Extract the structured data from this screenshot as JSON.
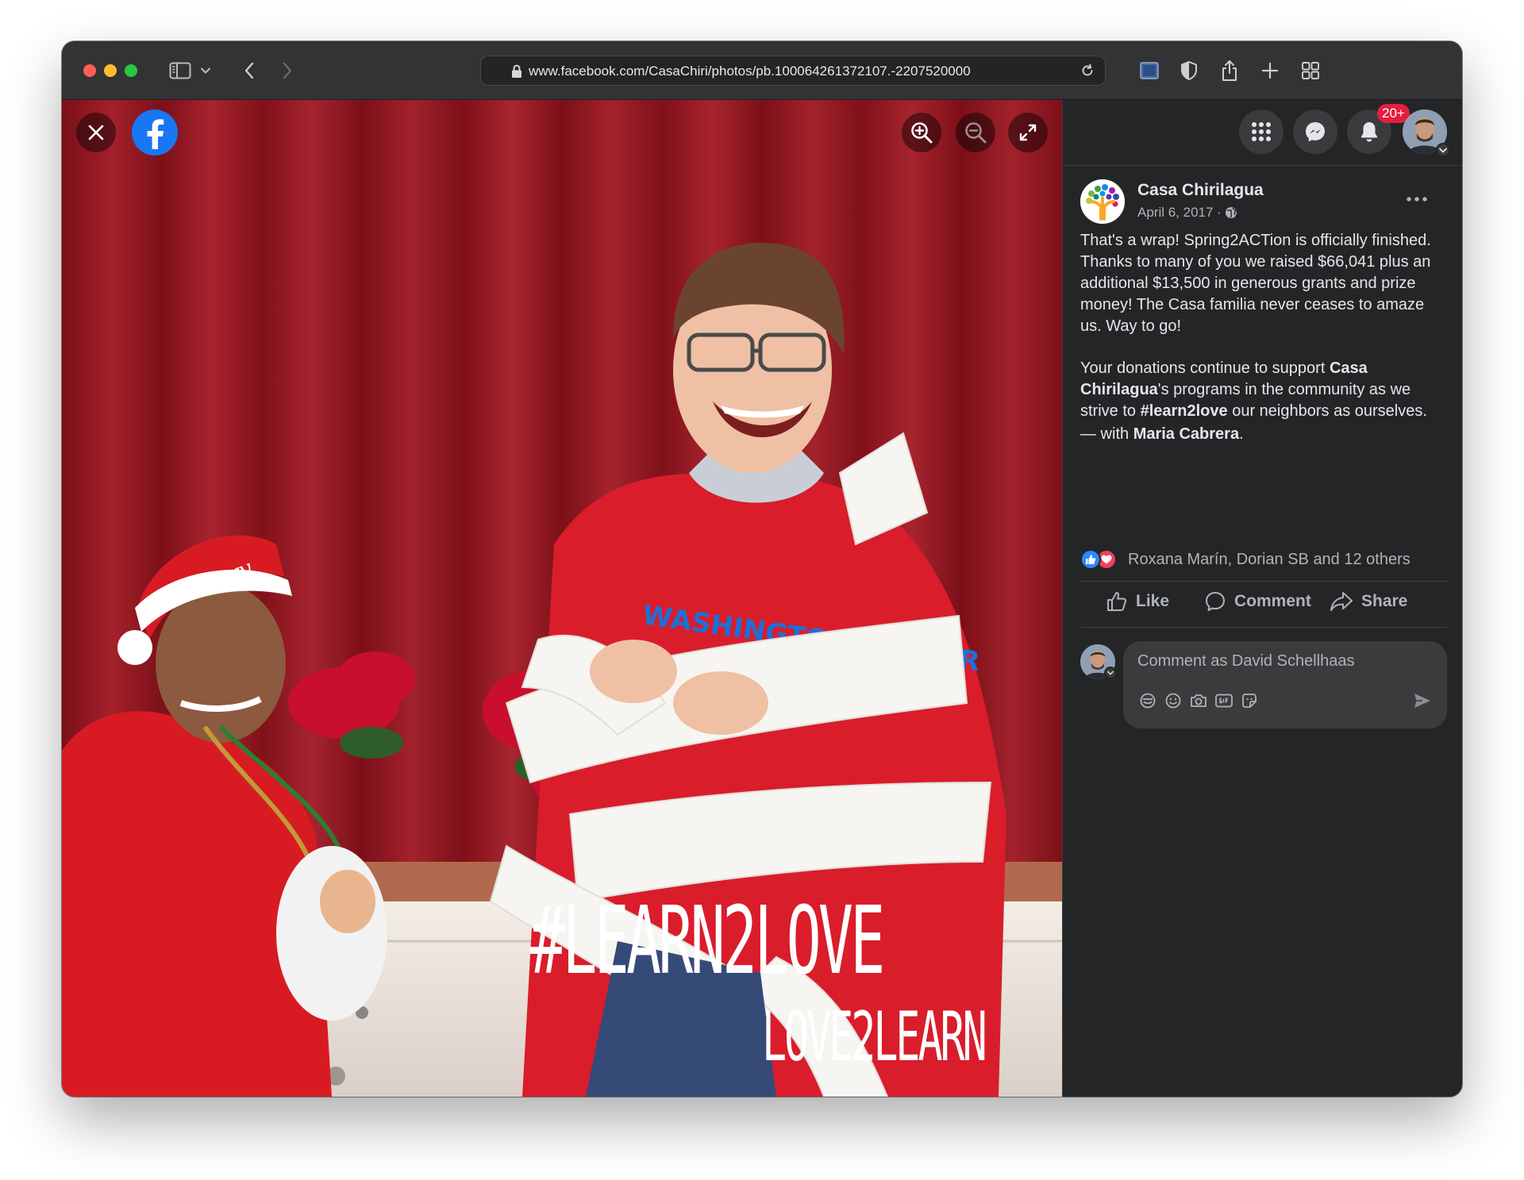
{
  "browser": {
    "url": "www.facebook.com/CasaChiri/photos/pb.100064261372107.-2207520000"
  },
  "photo": {
    "hashtag_line1": "#LEARN2LOVE",
    "hashtag_line2": "LOVE2LEARN",
    "hat_text": "Merry",
    "shirt_text": "WASHINGTON SOCCER"
  },
  "header": {
    "notification_count": "20+"
  },
  "post": {
    "page_name": "Casa Chirilagua",
    "date": "April 6, 2017 ·",
    "paragraph1": "That's a wrap! Spring2ACTion is officially finished. Thanks to many of you we raised $66,041 plus an additional $13,500 in generous grants and prize money! The Casa familia never ceases to amaze us. Way to go!",
    "p2_start": "Your donations continue to support ",
    "p2_bold1": "Casa Chirilagua",
    "p2_mid": "'s programs in the community as we strive to ",
    "p2_bold2": "#learn2love",
    "p2_end": " our neighbors as ourselves.",
    "with_prefix": "— with ",
    "with_name": "Maria Cabrera",
    "with_suffix": ".",
    "reactions_text": "Roxana Marín, Dorian SB and 12 others"
  },
  "actions": {
    "like": "Like",
    "comment": "Comment",
    "share": "Share"
  },
  "comment_box": {
    "placeholder": "Comment as David Schellhaas"
  },
  "colors": {
    "facebook_blue": "#1877f2",
    "panel_bg": "#242526",
    "badge_red": "#e41e3f",
    "curtain_red": "#8d1720"
  }
}
